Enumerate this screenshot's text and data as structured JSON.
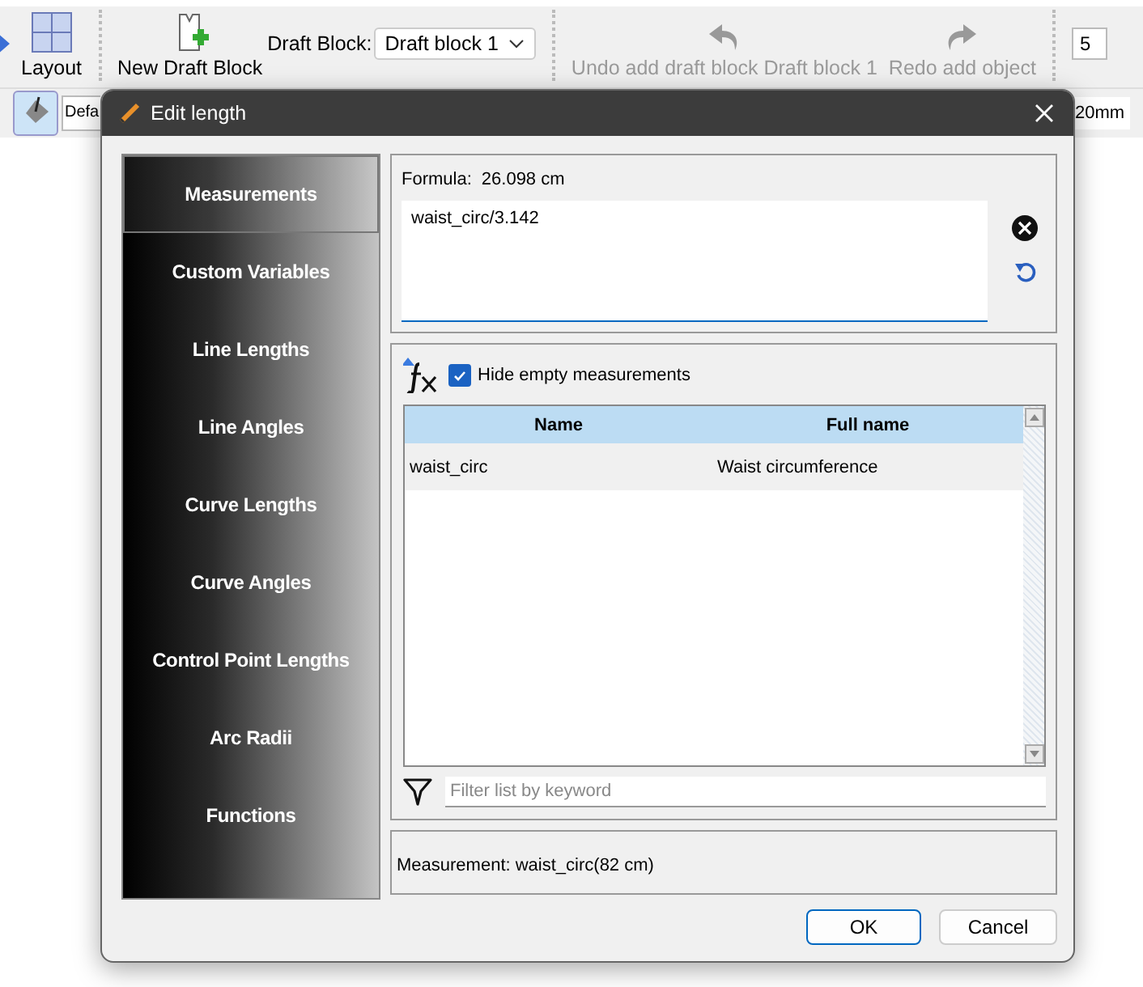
{
  "toolbar": {
    "layout_button": "Layout",
    "new_draft_block_button": "New Draft Block",
    "draft_block_label": "Draft Block:",
    "draft_block_select": "Draft block 1",
    "history_buttons": [
      {
        "kind": "undo",
        "label": "Undo add draft block Draft block 1",
        "disabled": true
      },
      {
        "kind": "redo",
        "label": "Redo add object",
        "disabled": true
      }
    ],
    "zoom_field": "5",
    "style_field": "Defa",
    "size_field": "20mm"
  },
  "dialog": {
    "title": "Edit length",
    "sidebar": {
      "items": [
        {
          "label": "Measurements",
          "selected": true
        },
        {
          "label": "Custom Variables",
          "selected": false
        },
        {
          "label": "Line Lengths",
          "selected": false
        },
        {
          "label": "Line Angles",
          "selected": false
        },
        {
          "label": "Curve Lengths",
          "selected": false
        },
        {
          "label": "Curve Angles",
          "selected": false
        },
        {
          "label": "Control Point Lengths",
          "selected": false
        },
        {
          "label": "Arc Radii",
          "selected": false
        },
        {
          "label": "Functions",
          "selected": false
        }
      ]
    },
    "formula_label": "Formula:",
    "formula_result": "26.098 cm",
    "formula": "waist_circ/3.142",
    "hide_empty": {
      "label": "Hide empty measurements",
      "checked": true
    },
    "table": {
      "columns": [
        "Name",
        "Full name"
      ],
      "rows": [
        [
          "waist_circ",
          "Waist circumference"
        ]
      ]
    },
    "filter": {
      "placeholder": "Filter list by keyword"
    },
    "status": "Measurement: waist_circ(82 cm)",
    "buttons": [
      {
        "label": "OK",
        "default": true
      },
      {
        "label": "Cancel",
        "default": false
      }
    ]
  }
}
